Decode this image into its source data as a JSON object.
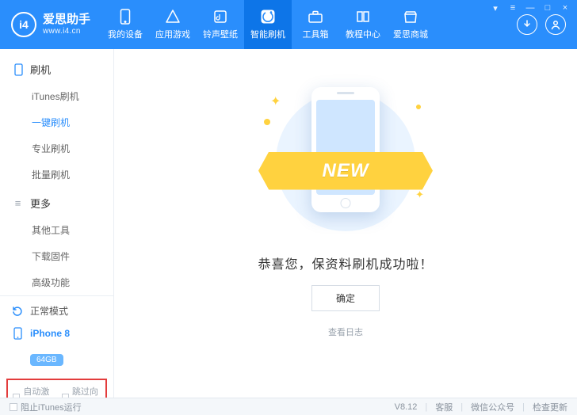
{
  "header": {
    "brand": "爱思助手",
    "url": "www.i4.cn",
    "nav": [
      {
        "label": "我的设备",
        "icon": "device"
      },
      {
        "label": "应用游戏",
        "icon": "apps"
      },
      {
        "label": "铃声壁纸",
        "icon": "music"
      },
      {
        "label": "智能刷机",
        "icon": "flash",
        "active": true
      },
      {
        "label": "工具箱",
        "icon": "toolbox"
      },
      {
        "label": "教程中心",
        "icon": "book"
      },
      {
        "label": "爱思商城",
        "icon": "store"
      }
    ],
    "syswin": [
      "▾",
      "≡",
      "—",
      "□",
      "×"
    ]
  },
  "sidebar": {
    "sections": [
      {
        "title": "刷机",
        "icon": "device-min",
        "items": [
          {
            "label": "iTunes刷机"
          },
          {
            "label": "一键刷机",
            "active": true
          },
          {
            "label": "专业刷机"
          },
          {
            "label": "批量刷机"
          }
        ]
      },
      {
        "title": "更多",
        "icon": "more",
        "items": [
          {
            "label": "其他工具"
          },
          {
            "label": "下载固件"
          },
          {
            "label": "高级功能"
          }
        ]
      }
    ],
    "status": {
      "mode_label": "正常模式",
      "device_label": "iPhone 8",
      "storage_badge": "64GB"
    },
    "checks": {
      "auto_activate": "自动激活",
      "skip_guide": "跳过向导"
    }
  },
  "main": {
    "ribbon_text": "NEW",
    "message": "恭喜您，保资料刷机成功啦！",
    "ok_label": "确定",
    "log_link": "查看日志"
  },
  "footer": {
    "block_itunes": "阻止iTunes运行",
    "version": "V8.12",
    "support": "客服",
    "wechat": "微信公众号",
    "check_update": "检查更新"
  }
}
